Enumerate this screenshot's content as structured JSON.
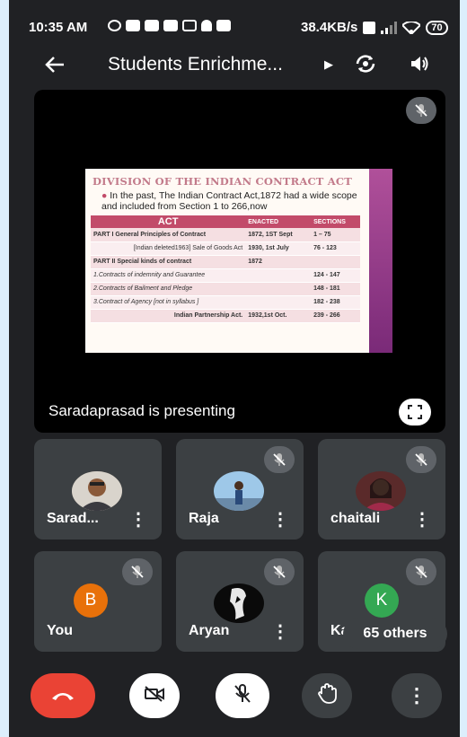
{
  "status_bar": {
    "time": "10:35 AM",
    "net_speed": "38.4KB/s",
    "battery": "70"
  },
  "top_bar": {
    "title": "Students Enrichme..."
  },
  "presentation": {
    "presenting_text": "Saradaprasad is presenting",
    "slide": {
      "title": "DIVISION OF THE INDIAN CONTRACT ACT",
      "intro": "In the past, The Indian Contract Act,1872 had a wide scope and included from Section 1 to 266,now",
      "headers": [
        "ACT",
        "ENACTED",
        "SECTIONS"
      ],
      "rows": [
        [
          "PART I General Principles of Contract",
          "1872, 1ST Sept",
          "1 – 75"
        ],
        [
          "[Indian deleted1963] Sale of Goods Act",
          "1930, 1st July",
          "76 - 123"
        ],
        [
          "PART II Special kinds of contract",
          "1872",
          ""
        ],
        [
          "1.Contracts of indemnity and Guarantee",
          "",
          "124 - 147"
        ],
        [
          "2.Contracts of Bailment and Pledge",
          "",
          "148 - 181"
        ],
        [
          "3.Contract of Agency [not in syllabus ]",
          "",
          "182 - 238"
        ],
        [
          "Indian Partnership Act.",
          "1932,1st Oct.",
          "239 - 266"
        ]
      ]
    }
  },
  "participants": [
    {
      "name": "Sarad..."
    },
    {
      "name": "Raja"
    },
    {
      "name": "chaitali"
    },
    {
      "name": "You",
      "initial": "B"
    },
    {
      "name": "Aryan"
    },
    {
      "name": "Ka",
      "initial": "K"
    }
  ],
  "others_label": "65 others",
  "colors": {
    "background": "#202124",
    "tile": "#3c4043",
    "hangup": "#ea4335",
    "avatar_b": "#e8710a",
    "avatar_k": "#34a853",
    "slide_header": "#c24b6a"
  }
}
